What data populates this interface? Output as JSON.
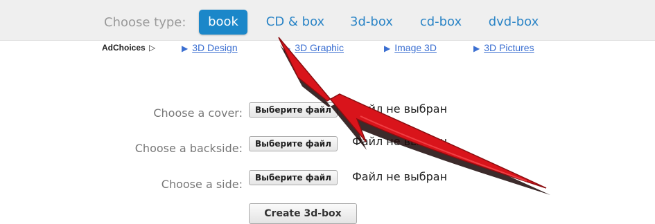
{
  "type_selector": {
    "label": "Choose type:",
    "tabs": [
      {
        "label": "book",
        "active": true
      },
      {
        "label": "CD & box",
        "active": false
      },
      {
        "label": "3d-box",
        "active": false
      },
      {
        "label": "cd-box",
        "active": false
      },
      {
        "label": "dvd-box",
        "active": false
      }
    ]
  },
  "ads": {
    "choices_label": "AdChoices",
    "choices_icon": "adchoices-icon",
    "links": [
      "3D Design",
      "3D Graphic",
      "Image 3D",
      "3D Pictures"
    ]
  },
  "form": {
    "rows": [
      {
        "label": "Choose a cover:",
        "button": "Выберите файл",
        "status": "Файл не выбран"
      },
      {
        "label": "Choose a backside:",
        "button": "Выберите файл",
        "status": "Файл не выбран"
      },
      {
        "label": "Choose a side:",
        "button": "Выберите файл",
        "status": "Файл не выбран"
      }
    ],
    "submit_label": "Create 3d-box"
  },
  "colors": {
    "accent": "#1b87c9",
    "tab_text": "#2a84c6",
    "link": "#3b6fd1",
    "arrow": "#d9141b"
  }
}
